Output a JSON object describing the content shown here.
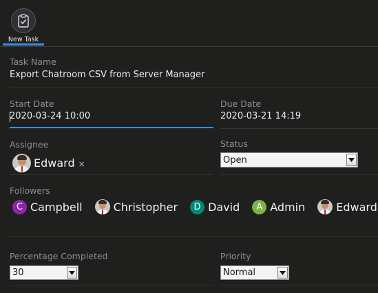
{
  "toolbar": {
    "new_task_label": "New Task"
  },
  "form": {
    "task_name_label": "Task Name",
    "task_name_value": "Export Chatroom CSV from Server Manager",
    "start_date_label": "Start Date",
    "start_date_value": "2020-03-24 10:00",
    "due_date_label": "Due Date",
    "due_date_value": "2020-03-21 14:19",
    "assignee_label": "Assignee",
    "assignee_name": "Edward",
    "assignee_remove_glyph": "×",
    "status_label": "Status",
    "status_value": "Open",
    "followers_label": "Followers",
    "followers": [
      {
        "name": "Campbell",
        "initial": "C",
        "color": "#8e24aa"
      },
      {
        "name": "Christopher"
      },
      {
        "name": "David",
        "initial": "D",
        "color": "#00897b"
      },
      {
        "name": "Admin",
        "initial": "A",
        "color": "#7cb342"
      },
      {
        "name": "Edward"
      }
    ],
    "percentage_label": "Percentage Completed",
    "percentage_value": "30",
    "priority_label": "Priority",
    "priority_value": "Normal"
  },
  "colors": {
    "accent": "#3a8ee6",
    "background": "#1f201e"
  }
}
